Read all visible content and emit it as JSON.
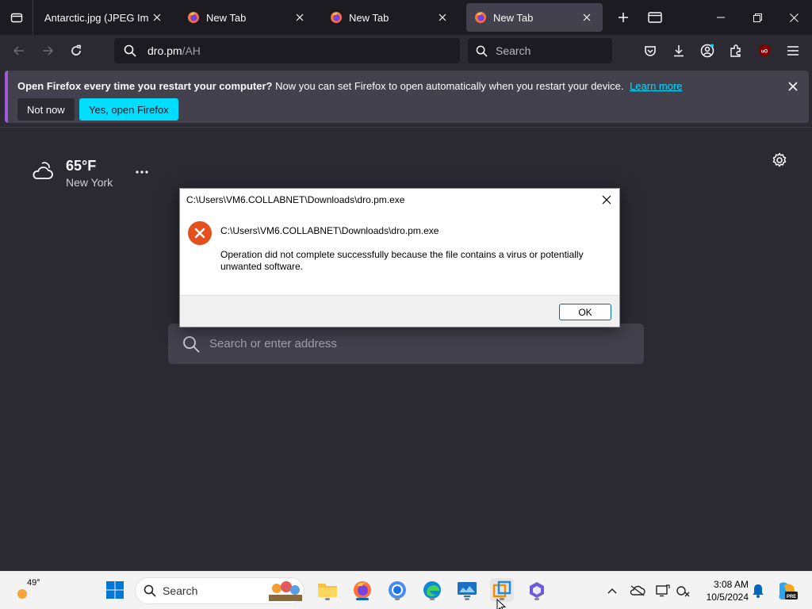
{
  "browser": {
    "tabs": [
      {
        "title": "Antarctic.jpg (JPEG Image, …",
        "active": false
      },
      {
        "title": "New Tab",
        "active": false
      },
      {
        "title": "New Tab",
        "active": false
      },
      {
        "title": "New Tab",
        "active": true
      }
    ],
    "url": {
      "host": "dro.pm",
      "path": "/AH"
    },
    "search_placeholder": "Search"
  },
  "notification": {
    "bold": "Open Firefox every time you restart your computer?",
    "text": "Now you can set Firefox to open automatically when you restart your device.",
    "link": "Learn more",
    "not_now": "Not now",
    "yes": "Yes, open Firefox"
  },
  "weather": {
    "temp": "65°F",
    "city": "New York"
  },
  "newtab_search_placeholder": "Search or enter address",
  "dialog": {
    "title": "C:\\Users\\VM6.COLLABNET\\Downloads\\dro.pm.exe",
    "path": "C:\\Users\\VM6.COLLABNET\\Downloads\\dro.pm.exe",
    "message": "Operation did not complete successfully because the file contains a virus or potentially unwanted software.",
    "ok": "OK"
  },
  "taskbar": {
    "weather_temp": "49°",
    "search_label": "Search",
    "time": "3:08 AM",
    "date": "10/5/2024"
  },
  "colors": {
    "accent": "#00ddff",
    "error": "#e3501e",
    "win_blue": "#0067c0"
  }
}
